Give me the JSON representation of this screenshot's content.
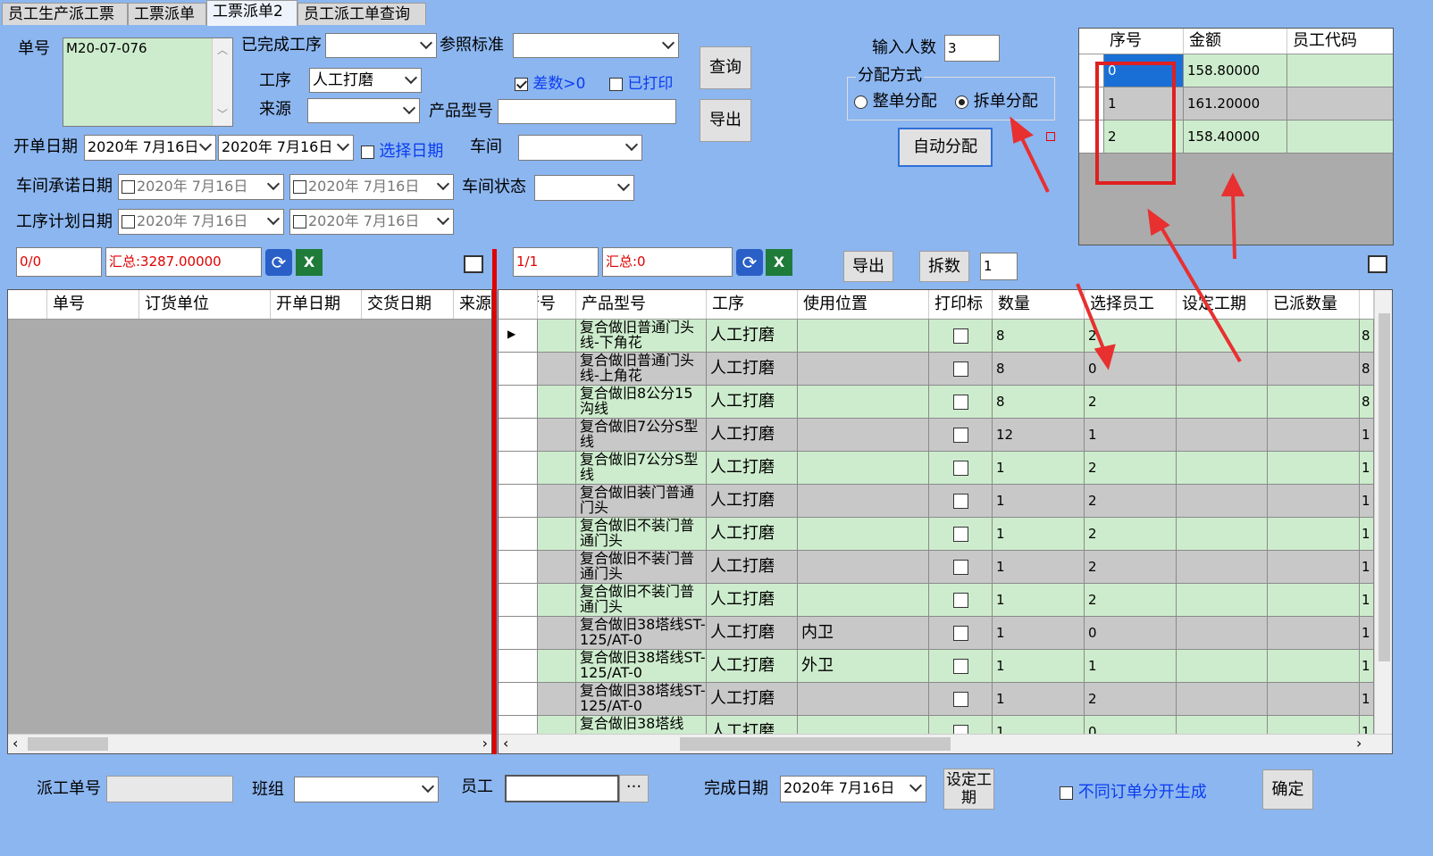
{
  "tabs": [
    "员工生产派工票",
    "工票派单",
    "工票派单2",
    "员工派工单查询"
  ],
  "filters": {
    "order_label": "单号",
    "order_value": "M20-07-076",
    "completed_process_label": "已完成工序",
    "reference_label": "参照标准",
    "process_label": "工序",
    "process_value": "人工打磨",
    "source_label": "来源",
    "diff_label": "差数>0",
    "printed_label": "已打印",
    "product_model_label": "产品型号",
    "open_date_label": "开单日期",
    "open_date_from": "2020年  7月16日",
    "open_date_to": "2020年  7月16日",
    "choose_date_label": "选择日期",
    "workshop_label": "车间",
    "workshop_promise_label": "车间承诺日期",
    "workshop_status_label": "车间状态",
    "process_plan_label": "工序计划日期",
    "date_placeholder": "2020年  7月16日"
  },
  "buttons": {
    "query": "查询",
    "export": "导出",
    "auto_assign": "自动分配",
    "export2": "导出",
    "split": "拆数",
    "set_hours": "设定工期",
    "confirm": "确定"
  },
  "assign": {
    "people_label": "输入人数",
    "people_value": "3",
    "mode_label": "分配方式",
    "whole_label": "整单分配",
    "split_label": "拆单分配",
    "split_value": "1"
  },
  "result_table": {
    "headers": [
      "序号",
      "金额",
      "员工代码"
    ],
    "rows": [
      {
        "seq": "0",
        "amount": "158.80000",
        "code": ""
      },
      {
        "seq": "1",
        "amount": "161.20000",
        "code": ""
      },
      {
        "seq": "2",
        "amount": "158.40000",
        "code": ""
      }
    ]
  },
  "left_summary": {
    "count": "0/0",
    "total": "汇总:3287.00000"
  },
  "right_summary": {
    "count": "1/1",
    "total": "汇总:0"
  },
  "left_grid": {
    "headers": [
      "单号",
      "订货单位",
      "开单日期",
      "交货日期",
      "来源"
    ]
  },
  "right_grid": {
    "headers": [
      "行号",
      "产品型号",
      "工序",
      "使用位置",
      "打印标",
      "数量",
      "选择员工",
      "设定工期",
      "已派数量"
    ],
    "rows": [
      {
        "model": "复合做旧普通门头线-下角花",
        "process": "人工打磨",
        "pos": "",
        "qty": "8",
        "emp": "2",
        "last": "8"
      },
      {
        "model": "复合做旧普通门头线-上角花",
        "process": "人工打磨",
        "pos": "",
        "qty": "8",
        "emp": "0",
        "last": "8"
      },
      {
        "model": "复合做旧8公分15沟线",
        "process": "人工打磨",
        "pos": "",
        "qty": "8",
        "emp": "2",
        "last": "8"
      },
      {
        "model": "复合做旧7公分S型线",
        "process": "人工打磨",
        "pos": "",
        "qty": "12",
        "emp": "1",
        "last": "1"
      },
      {
        "model": "复合做旧7公分S型线",
        "process": "人工打磨",
        "pos": "",
        "qty": "1",
        "emp": "2",
        "last": "1"
      },
      {
        "model": "复合做旧装门普通门头",
        "process": "人工打磨",
        "pos": "",
        "qty": "1",
        "emp": "2",
        "last": "1"
      },
      {
        "model": "复合做旧不装门普通门头",
        "process": "人工打磨",
        "pos": "",
        "qty": "1",
        "emp": "2",
        "last": "1"
      },
      {
        "model": "复合做旧不装门普通门头",
        "process": "人工打磨",
        "pos": "",
        "qty": "1",
        "emp": "2",
        "last": "1"
      },
      {
        "model": "复合做旧不装门普通门头",
        "process": "人工打磨",
        "pos": "",
        "qty": "1",
        "emp": "2",
        "last": "1"
      },
      {
        "model": "复合做旧38塔线ST-125/AT-0",
        "process": "人工打磨",
        "pos": "内卫",
        "qty": "1",
        "emp": "0",
        "last": "1"
      },
      {
        "model": "复合做旧38塔线ST-125/AT-0",
        "process": "人工打磨",
        "pos": "外卫",
        "qty": "1",
        "emp": "1",
        "last": "1"
      },
      {
        "model": "复合做旧38塔线ST-125/AT-0",
        "process": "人工打磨",
        "pos": "",
        "qty": "1",
        "emp": "2",
        "last": "1"
      },
      {
        "model": "复合做旧38塔线",
        "process": "人工打磨",
        "pos": "",
        "qty": "1",
        "emp": "0",
        "last": "1"
      }
    ]
  },
  "bottom": {
    "dispatch_label": "派工单号",
    "team_label": "班组",
    "employee_label": "员工",
    "finish_date_label": "完成日期",
    "finish_date_value": "2020年  7月16日",
    "separate_label": "不同订单分开生成"
  }
}
